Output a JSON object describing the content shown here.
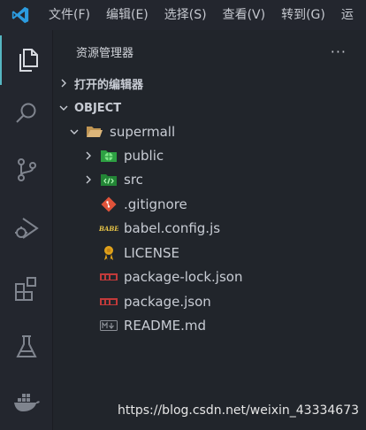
{
  "menubar": {
    "items": [
      "文件(F)",
      "编辑(E)",
      "选择(S)",
      "查看(V)",
      "转到(G)"
    ],
    "overflow": "运"
  },
  "activity_bar": {
    "icons": [
      "explorer-icon",
      "search-icon",
      "source-control-icon",
      "run-debug-icon",
      "extensions-icon",
      "testing-icon",
      "docker-icon"
    ]
  },
  "sidebar": {
    "title": "资源管理器",
    "more": "···",
    "open_editors": "打开的编辑器",
    "workspace": "OBJECT"
  },
  "tree": {
    "root": "supermall",
    "items": [
      {
        "label": "public",
        "icon": "public-folder-icon",
        "type": "folder"
      },
      {
        "label": "src",
        "icon": "src-folder-icon",
        "type": "folder"
      },
      {
        "label": ".gitignore",
        "icon": "git-icon",
        "type": "file"
      },
      {
        "label": "babel.config.js",
        "icon": "babel-icon",
        "type": "file"
      },
      {
        "label": "LICENSE",
        "icon": "license-icon",
        "type": "file"
      },
      {
        "label": "package-lock.json",
        "icon": "npm-icon",
        "type": "file"
      },
      {
        "label": "package.json",
        "icon": "npm-icon",
        "type": "file"
      },
      {
        "label": "README.md",
        "icon": "markdown-icon",
        "type": "file"
      }
    ]
  },
  "watermark": "https://blog.csdn.net/weixin_43334673",
  "colors": {
    "background": "#1f2229",
    "activity_accent": "#56b6c2",
    "vscode_blue": "#2c9ce0",
    "npm_red": "#c23a3a",
    "git_red": "#e0533a",
    "public_green": "#3fb950"
  }
}
